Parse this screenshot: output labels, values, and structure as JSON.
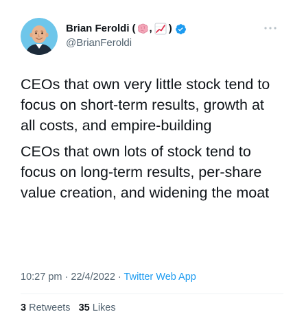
{
  "author": {
    "name": "Brian Feroldi",
    "name_open": "(",
    "name_sep": ",",
    "name_close": ")",
    "emoji_1": "brain-emoji",
    "emoji_2": "chart-increasing-emoji",
    "handle": "@BrianFeroldi",
    "verified": true
  },
  "tweet": {
    "paragraphs": [
      "CEOs that own very little stock tend to focus on short-term results, growth at all costs, and empire-building",
      "CEOs that own lots of stock tend to focus on long-term results, per-share value creation, and widening the moat"
    ]
  },
  "meta": {
    "time": "10:27 pm",
    "separator": "·",
    "date": "22/4/2022",
    "source": "Twitter Web App"
  },
  "stats": {
    "retweets_count": "3",
    "retweets_label": "Retweets",
    "likes_count": "35",
    "likes_label": "Likes"
  },
  "colors": {
    "text": "#0f1419",
    "secondary": "#536471",
    "accent": "#1d9bf0",
    "divider": "#eff3f4"
  }
}
